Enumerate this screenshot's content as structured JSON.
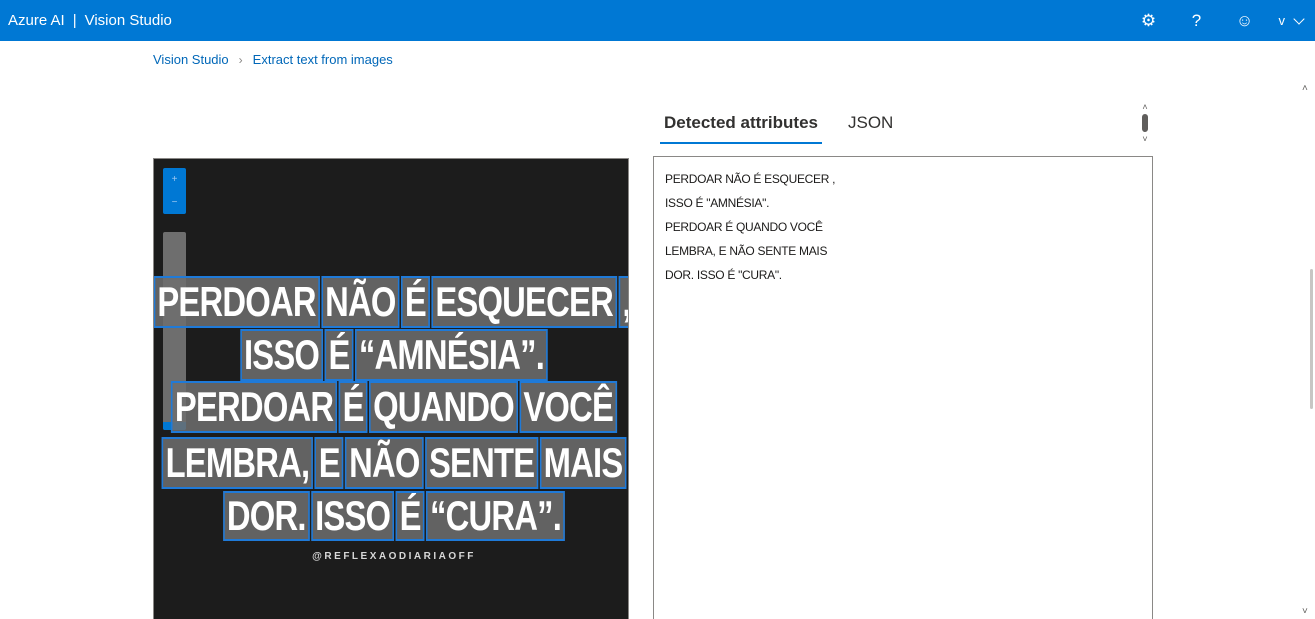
{
  "topbar": {
    "product": "Azure AI",
    "separator": "|",
    "app": "Vision Studio",
    "icons": [
      "settings-gear-icon",
      "help-question-icon",
      "feedback-smiley-icon"
    ],
    "settings_glyph": "⚙",
    "help_glyph": "?",
    "feedback_glyph": "☺",
    "user_initial": "v",
    "accent_color": "#0078d4"
  },
  "breadcrumb": {
    "items": [
      "Vision Studio",
      "Extract text from images"
    ],
    "separator": "›"
  },
  "image_viewer": {
    "zoom_in_glyph": "+",
    "zoom_out_glyph": "−",
    "zoom_level": 0.02,
    "ocr_lines": [
      [
        "PERDOAR",
        "NÃO",
        "É",
        "ESQUECER",
        ","
      ],
      [
        "ISSO",
        "É",
        "“AMNÉSIA”."
      ],
      [
        "PERDOAR",
        "É",
        "QUANDO",
        "VOCÊ"
      ],
      [
        "LEMBRA,",
        "E",
        "NÃO",
        "SENTE",
        "MAIS"
      ],
      [
        "DOR.",
        "ISSO",
        "É",
        "“CURA”."
      ]
    ],
    "watermark": "@REFLEXAODIARIAOFF",
    "box_color": "#1f7ad8"
  },
  "tabs": {
    "items": [
      "Detected attributes",
      "JSON"
    ],
    "active": "Detected attributes"
  },
  "result": {
    "lines": [
      "PERDOAR NÃO É ESQUECER ,",
      "ISSO É \"AMNÉSIA\".",
      "PERDOAR É QUANDO VOCÊ",
      "LEMBRA, E NÃO SENTE MAIS",
      "DOR. ISSO É \"CURA\"."
    ]
  }
}
